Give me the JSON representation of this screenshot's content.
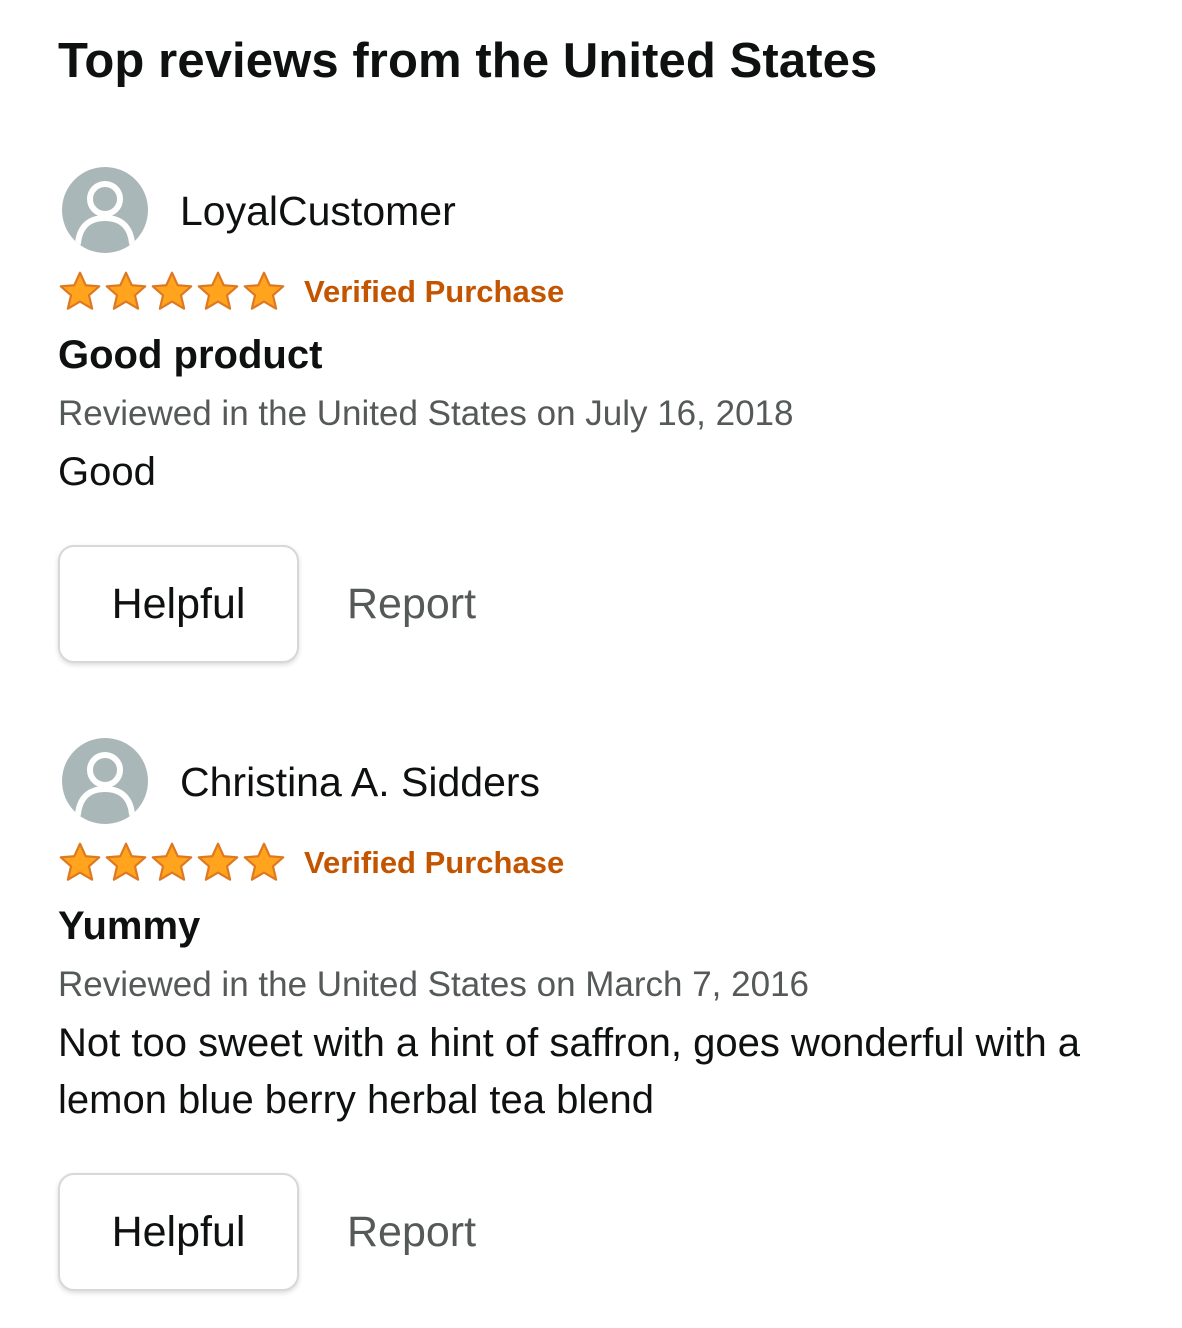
{
  "page": {
    "title": "Top reviews from the United States"
  },
  "colors": {
    "star_fill": "#ffa41c",
    "star_outline": "#de7921",
    "verified": "#c45500",
    "avatar_bg": "#aab7b8",
    "date_text": "#565959"
  },
  "reviews": [
    {
      "reviewer": "LoyalCustomer",
      "rating": 5,
      "rating_max": 5,
      "badge": "Verified Purchase",
      "title": "Good product",
      "date": "Reviewed in the United States on July 16, 2018",
      "body": "Good",
      "helpful_label": "Helpful",
      "report_label": "Report"
    },
    {
      "reviewer": "Christina A. Sidders",
      "rating": 5,
      "rating_max": 5,
      "badge": "Verified Purchase",
      "title": "Yummy",
      "date": "Reviewed in the United States on March 7, 2016",
      "body": "Not too sweet with a hint of saffron, goes wonderful with a lemon blue berry herbal tea blend",
      "helpful_label": "Helpful",
      "report_label": "Report"
    }
  ],
  "icons": {
    "avatar": "default-user-avatar-icon",
    "star": "star-icon"
  }
}
